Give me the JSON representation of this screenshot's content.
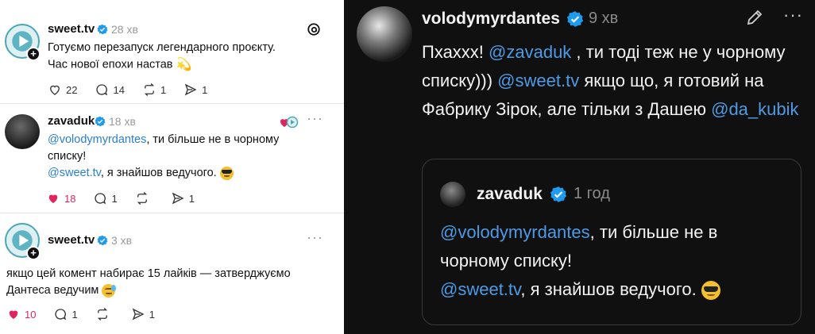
{
  "left": {
    "posts": [
      {
        "username": "sweet.tv",
        "time": "28 хв",
        "text_line1": "Готуємо перезапуск легендарного проєкту.",
        "text_line2": "Час нової епохи настав",
        "emoji": "dizzy",
        "actions": {
          "likes": "22",
          "comments": "14",
          "reposts": "1",
          "shares": "1"
        },
        "liked": false
      },
      {
        "username": "zavaduk",
        "time": "18 хв",
        "mention1": "@volodymyrdantes",
        "text1": ", ти більше не в чорному",
        "text2": "списку!",
        "mention2": "@sweet.tv",
        "text3": ", я знайшов ведучого.",
        "emoji": "sunglasses",
        "actions": {
          "likes": "18",
          "comments": "1",
          "reposts": "",
          "shares": "1"
        },
        "liked": true
      },
      {
        "username": "sweet.tv",
        "time": "3 хв",
        "text_line1": "якщо цей комент набирає 15 лайків — затверджуємо",
        "text_line2": "Дантеса ведучим",
        "emoji": "sweat-smile",
        "actions": {
          "likes": "10",
          "comments": "1",
          "reposts": "",
          "shares": "1"
        },
        "liked": true
      }
    ]
  },
  "right": {
    "username": "volodymyrdantes",
    "time": "9 хв",
    "text_part1": "Пхахxx! ",
    "mention1": "@zavaduk",
    "text_part2": " , ти тоді теж не у  чорному списку))) ",
    "mention2": "@sweet.tv",
    "text_part3": " якщо що, я готовий на Фабрику Зірок, але тільки з Дашею ",
    "mention3": "@da_kubik",
    "quote": {
      "username": "zavaduk",
      "time": "1 год",
      "mention1": "@volodymyrdantes",
      "text1": ", ти більше не в",
      "text2": "чорному списку!",
      "mention2": "@sweet.tv",
      "text3": ", я знайшов ведучого."
    }
  },
  "colors": {
    "mention_light": "#2a7fd0",
    "mention_dark": "#4d9be6",
    "verified": "#1d9bf0",
    "like_red": "#e0245e",
    "dark_bg": "#101010"
  },
  "icons": [
    "threads-logo-icon",
    "heart-icon",
    "comment-icon",
    "repost-icon",
    "share-icon",
    "edit-pencil-icon",
    "more-icon",
    "verified-badge-icon"
  ]
}
